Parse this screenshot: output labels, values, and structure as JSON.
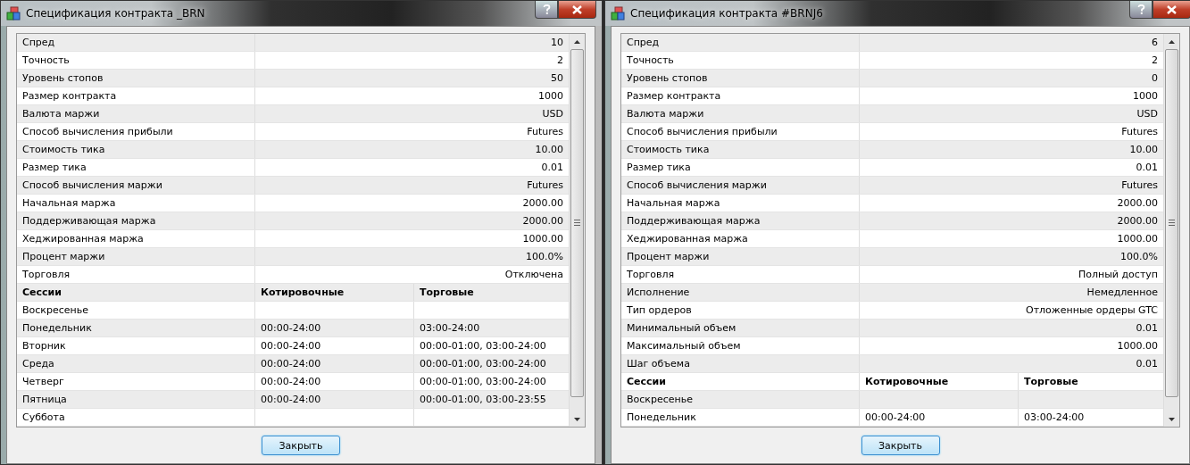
{
  "windows": [
    {
      "title": "Спецификация контракта _BRN",
      "params": [
        {
          "label": "Спред",
          "value": "10"
        },
        {
          "label": "Точность",
          "value": "2"
        },
        {
          "label": "Уровень стопов",
          "value": "50"
        },
        {
          "label": "Размер контракта",
          "value": "1000"
        },
        {
          "label": "Валюта маржи",
          "value": "USD"
        },
        {
          "label": "Способ вычисления прибыли",
          "value": "Futures"
        },
        {
          "label": "Стоимость тика",
          "value": "10.00"
        },
        {
          "label": "Размер тика",
          "value": "0.01"
        },
        {
          "label": "Способ вычисления маржи",
          "value": "Futures"
        },
        {
          "label": "Начальная маржа",
          "value": "2000.00"
        },
        {
          "label": "Поддерживающая маржа",
          "value": "2000.00"
        },
        {
          "label": "Хеджированная маржа",
          "value": "1000.00"
        },
        {
          "label": "Процент маржи",
          "value": "100.0%"
        },
        {
          "label": "Торговля",
          "value": "Отключена"
        }
      ],
      "session_columns": [
        "Сессии",
        "Котировочные",
        "Торговые"
      ],
      "sessions": [
        {
          "day": "Воскресенье"
        },
        {
          "day": "Понедельник",
          "quotes": "00:00-24:00",
          "trades": "03:00-24:00"
        },
        {
          "day": "Вторник",
          "quotes": "00:00-24:00",
          "trades": "00:00-01:00, 03:00-24:00"
        },
        {
          "day": "Среда",
          "quotes": "00:00-24:00",
          "trades": "00:00-01:00, 03:00-24:00"
        },
        {
          "day": "Четверг",
          "quotes": "00:00-24:00",
          "trades": "00:00-01:00, 03:00-24:00"
        },
        {
          "day": "Пятница",
          "quotes": "00:00-24:00",
          "trades": "00:00-01:00, 03:00-23:55"
        },
        {
          "day": "Суббота"
        }
      ],
      "close_button": "Закрыть"
    },
    {
      "title": "Спецификация контракта #BRNJ6",
      "params": [
        {
          "label": "Спред",
          "value": "6"
        },
        {
          "label": "Точность",
          "value": "2"
        },
        {
          "label": "Уровень стопов",
          "value": "0"
        },
        {
          "label": "Размер контракта",
          "value": "1000"
        },
        {
          "label": "Валюта маржи",
          "value": "USD"
        },
        {
          "label": "Способ вычисления прибыли",
          "value": "Futures"
        },
        {
          "label": "Стоимость тика",
          "value": "10.00"
        },
        {
          "label": "Размер тика",
          "value": "0.01"
        },
        {
          "label": "Способ вычисления маржи",
          "value": "Futures"
        },
        {
          "label": "Начальная маржа",
          "value": "2000.00"
        },
        {
          "label": "Поддерживающая маржа",
          "value": "2000.00"
        },
        {
          "label": "Хеджированная маржа",
          "value": "1000.00"
        },
        {
          "label": "Процент маржи",
          "value": "100.0%"
        },
        {
          "label": "Торговля",
          "value": "Полный доступ"
        },
        {
          "label": "Исполнение",
          "value": "Немедленное"
        },
        {
          "label": "Тип ордеров",
          "value": "Отложенные ордеры GTC"
        },
        {
          "label": "Минимальный объем",
          "value": "0.01"
        },
        {
          "label": "Максимальный объем",
          "value": "1000.00"
        },
        {
          "label": "Шаг объема",
          "value": "0.01"
        }
      ],
      "session_columns": [
        "Сессии",
        "Котировочные",
        "Торговые"
      ],
      "sessions": [
        {
          "day": "Воскресенье"
        },
        {
          "day": "Понедельник",
          "quotes": "00:00-24:00",
          "trades": "03:00-24:00"
        }
      ],
      "close_button": "Закрыть"
    }
  ]
}
